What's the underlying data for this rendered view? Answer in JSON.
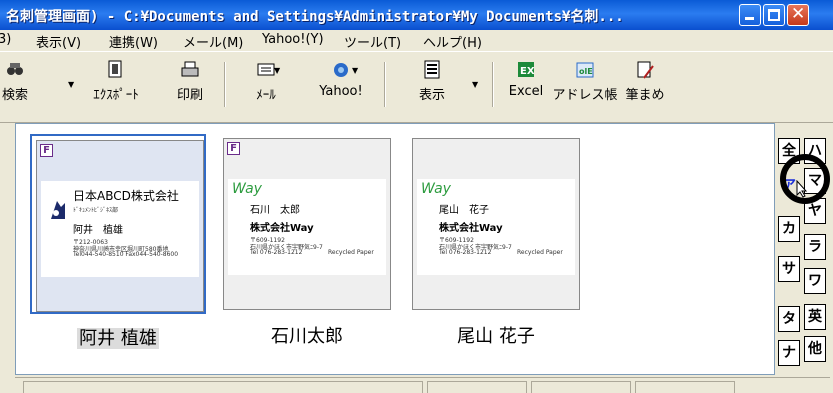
{
  "window": {
    "title": "名刺管理画面) - C:¥Documents and Settings¥Administrator¥My Documents¥名刺..."
  },
  "menu": [
    {
      "label": "3)"
    },
    {
      "label": "表示(V)"
    },
    {
      "label": "連携(W)"
    },
    {
      "label": "メール(M)"
    },
    {
      "label": "Yahoo!(Y)"
    },
    {
      "label": "ツール(T)"
    },
    {
      "label": "ヘルプ(H)"
    }
  ],
  "toolbar": [
    {
      "label": "検索",
      "icon": "binoculars-icon"
    },
    {
      "label": "ｴｸｽﾎﾟｰﾄ",
      "icon": "export-icon"
    },
    {
      "label": "印刷",
      "icon": "printer-icon"
    },
    {
      "label": "ﾒｰﾙ",
      "icon": "mail-icon"
    },
    {
      "label": "Yahoo!",
      "icon": "yahoo-icon"
    },
    {
      "label": "表示",
      "icon": "view-icon"
    },
    {
      "label": "Excel",
      "icon": "excel-icon"
    },
    {
      "label": "アドレス帳",
      "icon": "addressbook-icon"
    },
    {
      "label": "筆まめ",
      "icon": "hudemame-icon"
    }
  ],
  "cards": [
    {
      "caption": "阿井 植雄",
      "flag": "F",
      "company": "日本ABCD株式会社",
      "dept": "ﾄﾞｷｭﾒﾝﾄﾋﾞｼﾞﾈｽ部",
      "name": "阿井　植雄",
      "addr1": "〒212-0063",
      "addr2": "神奈川県川崎市幸区堀川町580番地",
      "addr3": "Tel044-540-8510 Fax044-540-8600",
      "selected": true
    },
    {
      "caption": "石川太郎",
      "flag": "F",
      "logo": "Way",
      "name": "石川　太郎",
      "company": "株式会社Way",
      "addr1": "〒609-1192",
      "addr2": "石川県かほく市宇野気ﾆ9-7",
      "addr3": "Tel 076-283-1212",
      "note": "Recycled Paper",
      "selected": false
    },
    {
      "caption": "尾山 花子",
      "flag": "",
      "logo": "Way",
      "name": "尾山　花子",
      "company": "株式会社Way",
      "addr1": "〒609-1192",
      "addr2": "石川県かほく市宇野気ﾆ9-7",
      "addr3": "Tel 076-283-1212",
      "note": "Recycled Paper",
      "selected": false
    }
  ],
  "index_tabs": {
    "left": [
      "全",
      "ア",
      "カ",
      "サ",
      "タ",
      "ナ"
    ],
    "right": [
      "ハ",
      "マ",
      "ヤ",
      "ラ",
      "ワ",
      "英",
      "他"
    ],
    "active": "ア"
  },
  "colors": {
    "titlebar": "#0a5bd6",
    "selection": "#316ac5",
    "active_index": "#1a2fd8",
    "way_green": "#2e9c40"
  }
}
